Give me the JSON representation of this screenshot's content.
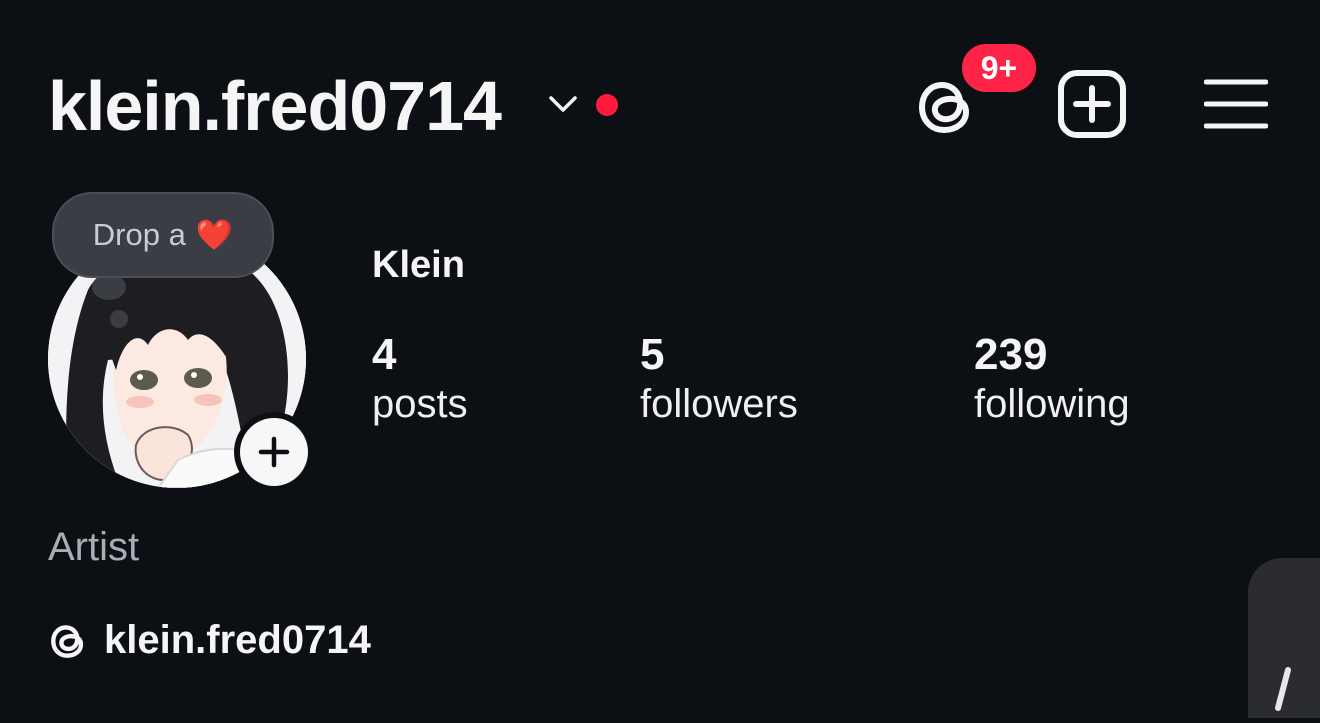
{
  "header": {
    "username": "klein.fred0714",
    "notification_count": "9+"
  },
  "profile": {
    "note": "Drop a",
    "note_emoji": "❤️",
    "display_name": "Klein",
    "bio": "Artist",
    "threads_handle": "klein.fred0714"
  },
  "stats": [
    {
      "value": "4",
      "label": "posts"
    },
    {
      "value": "5",
      "label": "followers"
    },
    {
      "value": "239",
      "label": "following"
    }
  ],
  "colors": {
    "background": "#0c0f14",
    "badge": "#ff2447",
    "live_dot": "#ff1b3d"
  }
}
